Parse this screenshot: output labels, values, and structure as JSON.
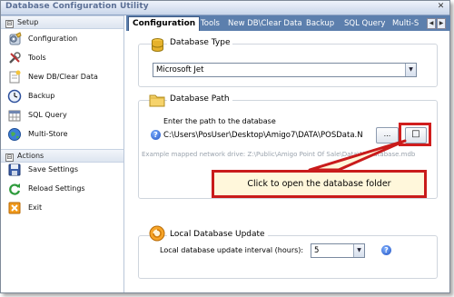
{
  "window": {
    "title": "Database Configuration Utility",
    "close_glyph": "✕"
  },
  "sidebar": {
    "groups": [
      {
        "label": "Setup",
        "toggle": "⊟"
      },
      {
        "label": "Actions",
        "toggle": "⊟"
      }
    ],
    "setup_items": [
      {
        "label": "Configuration",
        "icon": "gear-config-icon"
      },
      {
        "label": "Tools",
        "icon": "tools-icon"
      },
      {
        "label": "New DB/Clear Data",
        "icon": "new-db-icon"
      },
      {
        "label": "Backup",
        "icon": "clock-backup-icon"
      },
      {
        "label": "SQL Query",
        "icon": "sql-query-icon"
      },
      {
        "label": "Multi-Store",
        "icon": "globe-icon"
      }
    ],
    "action_items": [
      {
        "label": "Save Settings",
        "icon": "save-disk-icon"
      },
      {
        "label": "Reload Settings",
        "icon": "reload-icon"
      },
      {
        "label": "Exit",
        "icon": "exit-icon"
      }
    ]
  },
  "tabs": [
    "Configuration",
    "Tools",
    "New DB\\Clear Data",
    "Backup",
    "SQL Query",
    "Multi-S"
  ],
  "tab_scroll": {
    "left": "◀",
    "right": "▶"
  },
  "database_type": {
    "title": "Database Type",
    "selected": "Microsoft Jet",
    "arrow": "▼"
  },
  "database_path": {
    "title": "Database Path",
    "prompt": "Enter the path to the database",
    "help": "?",
    "value": "C:\\Users\\PosUser\\Desktop\\Amigo7\\DATA\\POSData.N",
    "browse_label": "...",
    "open_folder_glyph": "□",
    "example": "Example mapped network drive:  Z:\\Public\\Amigo Point Of Sale\\Data\\MyDatabase.mdb"
  },
  "callout": {
    "text": "Click to open the database folder"
  },
  "local_update": {
    "title": "Local Database Update",
    "label": "Local database update interval (hours):",
    "value": "5",
    "arrow": "▼",
    "help": "?"
  },
  "colors": {
    "accent": "#5c7fad",
    "highlight": "#d01d1d",
    "callout_bg": "#fff7db"
  }
}
